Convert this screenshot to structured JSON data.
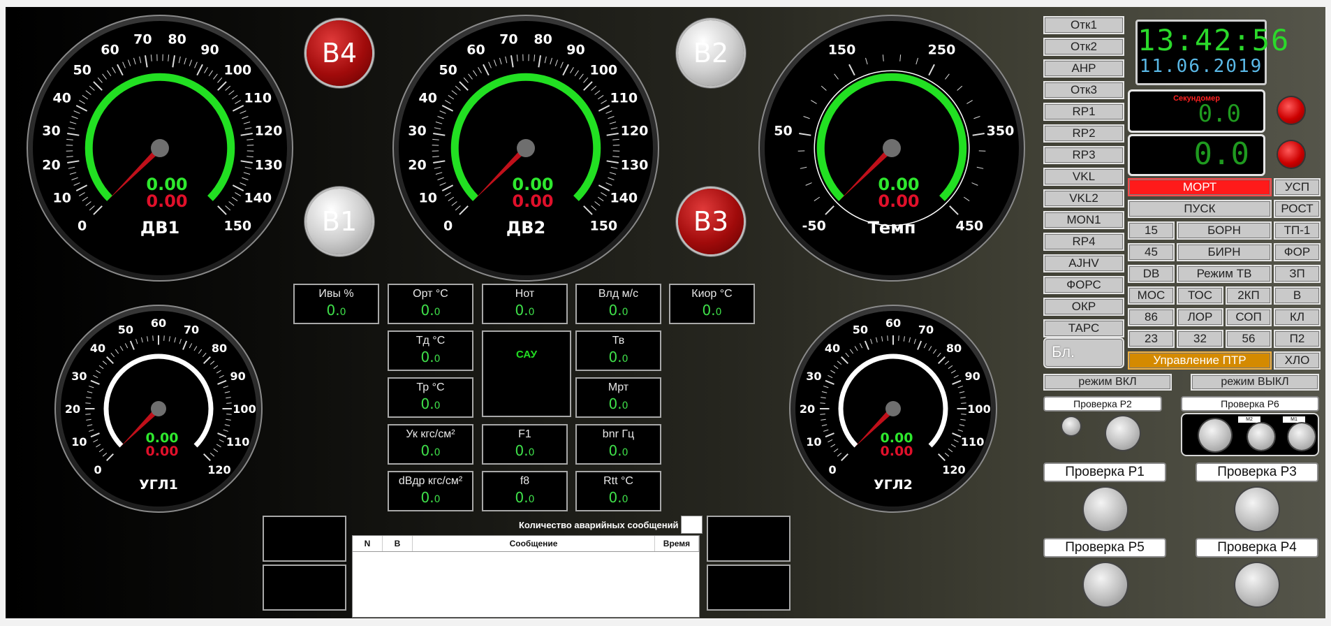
{
  "gauges": {
    "dv1": {
      "label": "ДВ1",
      "ticks": [
        "0",
        "10",
        "20",
        "30",
        "40",
        "50",
        "60",
        "70",
        "80",
        "90",
        "100",
        "110",
        "120",
        "130",
        "140",
        "150"
      ],
      "value_green": "0.00",
      "value_red": "0.00",
      "needle": 0
    },
    "dv2": {
      "label": "ДВ2",
      "ticks": [
        "0",
        "10",
        "20",
        "30",
        "40",
        "50",
        "60",
        "70",
        "80",
        "90",
        "100",
        "110",
        "120",
        "130",
        "140",
        "150"
      ],
      "value_green": "0.00",
      "value_red": "0.00",
      "needle": 0
    },
    "temp": {
      "label": "Темп",
      "ticks": [
        "-50",
        "50",
        "150",
        "250",
        "350",
        "450"
      ],
      "value_green": "0.00",
      "value_red": "0.00",
      "needle": 0
    },
    "ugl1": {
      "label": "УГЛ1",
      "ticks": [
        "0",
        "10",
        "20",
        "30",
        "40",
        "50",
        "60",
        "70",
        "80",
        "90",
        "100",
        "110",
        "120"
      ],
      "value_green": "0.00",
      "value_red": "0.00",
      "needle": 0
    },
    "ugl2": {
      "label": "УГЛ2",
      "ticks": [
        "0",
        "10",
        "20",
        "30",
        "40",
        "50",
        "60",
        "70",
        "80",
        "90",
        "100",
        "110",
        "120"
      ],
      "value_green": "0.00",
      "value_red": "0.00",
      "needle": 0
    }
  },
  "balls": {
    "b4": "B4",
    "b1": "B1",
    "b2": "B2",
    "b3": "B3"
  },
  "cells": [
    {
      "label": "Ивы %",
      "val_main": "0.",
      "val_small": "0"
    },
    {
      "label": "Орт °С",
      "val_main": "0.",
      "val_small": "0"
    },
    {
      "label": "Нот",
      "val_main": "0.",
      "val_small": "0"
    },
    {
      "label": "Влд м/с",
      "val_main": "0.",
      "val_small": "0"
    },
    {
      "label": "Киор °С",
      "val_main": "0.",
      "val_small": "0"
    },
    {
      "label": "Тд °С",
      "val_main": "0.",
      "val_small": "0"
    },
    {
      "label": "Тв",
      "val_main": "0.",
      "val_small": "0"
    },
    {
      "label": "Тр °С",
      "val_main": "0.",
      "val_small": "0"
    },
    {
      "label": "Мрт",
      "val_main": "0.",
      "val_small": "0"
    },
    {
      "label": "Ук кгс/см²",
      "val_main": "0.",
      "val_small": "0"
    },
    {
      "label": "F1",
      "val_main": "0.",
      "val_small": "0"
    },
    {
      "label": "bnr Гц",
      "val_main": "0.",
      "val_small": "0"
    },
    {
      "label": "dВдр кгс/см²",
      "val_main": "0.",
      "val_small": "0"
    },
    {
      "label": "f8",
      "val_main": "0.",
      "val_small": "0"
    },
    {
      "label": "Rtt °С",
      "val_main": "0.",
      "val_small": "0"
    }
  ],
  "sau": "САУ",
  "messages": {
    "count_label": "Количество аварийных сообщений",
    "col_n": "N",
    "col_b": "В",
    "col_msg": "Сообщение",
    "col_time": "Время"
  },
  "side_buttons": [
    "Отк1",
    "Отк2",
    "АНР",
    "Отк3",
    "RP1",
    "RP2",
    "RP3",
    "VKL",
    "VKL2",
    "MON1",
    "RP4",
    "AJHV",
    "ФОРС",
    "ОКР",
    "ТАРС"
  ],
  "bl_label": "Бл.",
  "clock": {
    "time": "13:42:56",
    "date": "11.06.2019"
  },
  "stopwatch": {
    "label": "Секундомер",
    "value1": "0.0",
    "value2": "0.0"
  },
  "grid": {
    "mort": "МОРТ",
    "usp": "УСП",
    "pusk": "ПУСК",
    "rost": "РОСТ",
    "b15": "15",
    "born": "БОРН",
    "tp1": "ТП-1",
    "b45": "45",
    "birn": "БИРН",
    "for": "ФОР",
    "db": "DB",
    "rezhim_tv": "Режим ТВ",
    "zp": "ЗП",
    "mos": "МОС",
    "tos": "ТОС",
    "kp2": "2КП",
    "v": "В",
    "b86": "86",
    "lor": "ЛОР",
    "sop": "СОП",
    "kl": "КЛ",
    "b23": "23",
    "b32": "32",
    "b56": "56",
    "p2": "П2",
    "ptr": "Управление ПТР",
    "khlo": "ХЛО"
  },
  "mode": {
    "on": "режим ВКЛ",
    "off": "режим ВЫКЛ"
  },
  "checks": {
    "p2": "Проверка Р2",
    "p6": "Проверка Р6",
    "p1": "Проверка Р1",
    "p3": "Проверка Р3",
    "p5": "Проверка Р5",
    "p4": "Проверка Р4",
    "m2": "М2",
    "m1": "М1"
  },
  "colors": {
    "green": "#2ee82e",
    "red": "#e0102a",
    "alarm": "#ff1a1a",
    "ptr": "#d48a00",
    "digit_green": "#2bd92b"
  }
}
